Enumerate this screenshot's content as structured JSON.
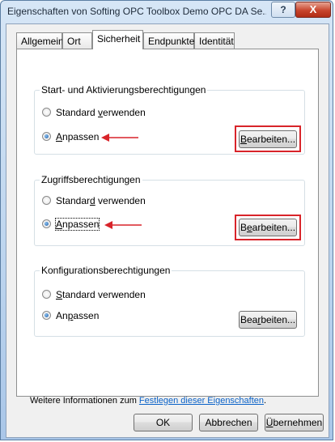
{
  "window": {
    "title": "Eigenschaften von Softing OPC Toolbox Demo OPC DA Se...",
    "help_label": "?",
    "close_label": "X"
  },
  "tabs": [
    {
      "label": "Allgemein",
      "active": false
    },
    {
      "label": "Ort",
      "active": false
    },
    {
      "label": "Sicherheit",
      "active": true
    },
    {
      "label": "Endpunkte",
      "active": false
    },
    {
      "label": "Identität",
      "active": false
    }
  ],
  "groups": [
    {
      "title": "Start- und Aktivierungsberechtigungen",
      "option_default": {
        "pre": "Standard ",
        "acc": "v",
        "post": "erwenden",
        "checked": false
      },
      "option_custom": {
        "pre": "",
        "acc": "A",
        "post": "npassen",
        "checked": true
      },
      "edit_button": {
        "pre": "",
        "acc": "B",
        "post": "earbeiten..."
      },
      "highlighted": true
    },
    {
      "title": "Zugriffsberechtigungen",
      "option_default": {
        "pre": "Standar",
        "acc": "d",
        "post": " verwenden",
        "checked": false
      },
      "option_custom": {
        "pre": "",
        "acc": "A",
        "post": "npassen",
        "checked": true
      },
      "edit_button": {
        "pre": "B",
        "acc": "e",
        "post": "arbeiten..."
      },
      "highlighted": true
    },
    {
      "title": "Konfigurationsberechtigungen",
      "option_default": {
        "pre": "",
        "acc": "S",
        "post": "tandard verwenden",
        "checked": false
      },
      "option_custom": {
        "pre": "An",
        "acc": "p",
        "post": "assen",
        "checked": true
      },
      "edit_button": {
        "pre": "Bea",
        "acc": "r",
        "post": "beiten..."
      },
      "highlighted": false
    }
  ],
  "info": {
    "prefix": "Weitere Informationen zum ",
    "link": "Festlegen dieser Eigenschaften",
    "suffix": "."
  },
  "buttons": {
    "ok": "OK",
    "cancel": "Abbrechen",
    "apply_acc": "Ü",
    "apply_rest": "bernehmen"
  },
  "annotation_color": "#d8242a"
}
